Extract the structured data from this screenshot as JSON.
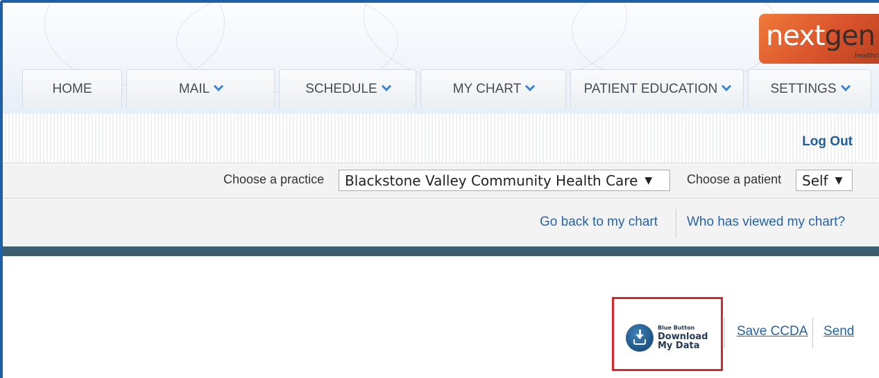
{
  "logo": {
    "part1": "next",
    "part2": "gen",
    "sub": "healthcare"
  },
  "nav": {
    "tabs": [
      {
        "label": "HOME",
        "has_dropdown": false
      },
      {
        "label": "MAIL",
        "has_dropdown": true
      },
      {
        "label": "SCHEDULE",
        "has_dropdown": true
      },
      {
        "label": "MY CHART",
        "has_dropdown": true
      },
      {
        "label": "PATIENT EDUCATION",
        "has_dropdown": true
      },
      {
        "label": "SETTINGS",
        "has_dropdown": true
      }
    ]
  },
  "session": {
    "logout_label": "Log Out"
  },
  "selectors": {
    "practice_label": "Choose a practice",
    "practice_value": "Blackstone Valley Community Health Care",
    "patient_label": "Choose a patient",
    "patient_value": "Self"
  },
  "links": {
    "back": "Go back to my chart",
    "viewed": "Who has viewed my chart?"
  },
  "actions": {
    "blue_button_small": "Blue Button",
    "blue_button_line1": "Download",
    "blue_button_line2": "My Data",
    "save_ccda": "Save CCDA",
    "send": "Send"
  },
  "colors": {
    "frame": "#1e5fa8",
    "link": "#2563a6",
    "highlight": "#d8262a",
    "bar": "#3a5e6e",
    "chevron": "#3a86d6"
  }
}
